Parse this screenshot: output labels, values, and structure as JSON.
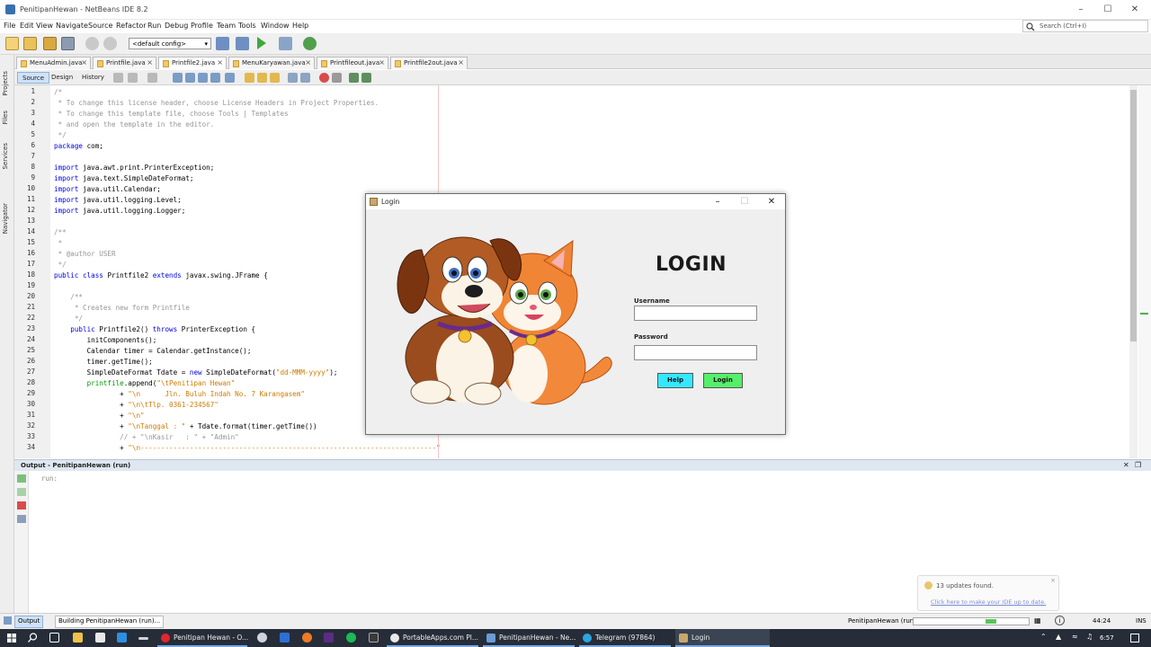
{
  "window": {
    "title": "PenitipanHewan - NetBeans IDE 8.2"
  },
  "menu": [
    "File",
    "Edit",
    "View",
    "Navigate",
    "Source",
    "Refactor",
    "Run",
    "Debug",
    "Profile",
    "Team",
    "Tools",
    "Window",
    "Help"
  ],
  "search": {
    "placeholder": "Search (Ctrl+I)"
  },
  "toolbar": {
    "config": "<default config>"
  },
  "side_tabs": [
    "Projects",
    "Files",
    "Services",
    "Navigator"
  ],
  "editor_tabs": [
    "MenuAdmin.java",
    "Printfile.java",
    "Printfile2.java",
    "MenuKaryawan.java",
    "Printfileout.java",
    "Printfile2out.java"
  ],
  "view_tabs": {
    "source": "Source",
    "design": "Design",
    "history": "History"
  },
  "code": {
    "line_numbers": [
      "1",
      "2",
      "3",
      "4",
      "5",
      "6",
      "7",
      "8",
      "9",
      "10",
      "11",
      "12",
      "13",
      "14",
      "15",
      "16",
      "17",
      "18",
      "19",
      "20",
      "21",
      "22",
      "23",
      "24",
      "25",
      "26",
      "27",
      "28",
      "29",
      "30",
      "31",
      "32",
      "33",
      "34"
    ],
    "lines": [
      [
        [
          "cmt",
          "/*"
        ]
      ],
      [
        [
          "cmt",
          " * To change this license header, choose License Headers in Project Properties."
        ]
      ],
      [
        [
          "cmt",
          " * To change this template file, choose Tools | Templates"
        ]
      ],
      [
        [
          "cmt",
          " * and open the template in the editor."
        ]
      ],
      [
        [
          "cmt",
          " */"
        ]
      ],
      [
        [
          "kw",
          "package"
        ],
        [
          "plain",
          " com;"
        ]
      ],
      [
        [
          "plain",
          ""
        ]
      ],
      [
        [
          "kw",
          "import"
        ],
        [
          "plain",
          " java.awt.print.PrinterException;"
        ]
      ],
      [
        [
          "kw",
          "import"
        ],
        [
          "plain",
          " java.text.SimpleDateFormat;"
        ]
      ],
      [
        [
          "kw",
          "import"
        ],
        [
          "plain",
          " java.util.Calendar;"
        ]
      ],
      [
        [
          "kw",
          "import"
        ],
        [
          "plain",
          " java.util.logging.Level;"
        ]
      ],
      [
        [
          "kw",
          "import"
        ],
        [
          "plain",
          " java.util.logging.Logger;"
        ]
      ],
      [
        [
          "plain",
          ""
        ]
      ],
      [
        [
          "cmt",
          "/**"
        ]
      ],
      [
        [
          "cmt",
          " *"
        ]
      ],
      [
        [
          "cmt",
          " * @author USER"
        ]
      ],
      [
        [
          "cmt",
          " */"
        ]
      ],
      [
        [
          "kw",
          "public class"
        ],
        [
          "plain",
          " Printfile2 "
        ],
        [
          "kw",
          "extends"
        ],
        [
          "plain",
          " javax.swing.JFrame {"
        ]
      ],
      [
        [
          "plain",
          ""
        ]
      ],
      [
        [
          "cmt",
          "    /**"
        ]
      ],
      [
        [
          "cmt",
          "     * Creates new form Printfile"
        ]
      ],
      [
        [
          "cmt",
          "     */"
        ]
      ],
      [
        [
          "kw",
          "    public"
        ],
        [
          "plain",
          " Printfile2() "
        ],
        [
          "kw",
          "throws"
        ],
        [
          "plain",
          " PrinterException {"
        ]
      ],
      [
        [
          "plain",
          "        initComponents();"
        ]
      ],
      [
        [
          "plain",
          "        Calendar timer = Calendar.getInstance();"
        ]
      ],
      [
        [
          "plain",
          "        timer.getTime();"
        ]
      ],
      [
        [
          "plain",
          "        SimpleDateFormat Tdate = "
        ],
        [
          "kw",
          "new"
        ],
        [
          "plain",
          " SimpleDateFormat("
        ],
        [
          "str",
          "\"dd-MMM-yyyy\""
        ],
        [
          "plain",
          ");"
        ]
      ],
      [
        [
          "fld",
          "        printfile"
        ],
        [
          "plain",
          ".append("
        ],
        [
          "str",
          "\"\\tPenitipan Hewan\""
        ]
      ],
      [
        [
          "plain",
          "                + "
        ],
        [
          "str",
          "\"\\n      Jln. Buluh Indah No. 7 Karangasem\""
        ]
      ],
      [
        [
          "plain",
          "                + "
        ],
        [
          "str",
          "\"\\n\\tTlp. 0361-234567\""
        ]
      ],
      [
        [
          "plain",
          "                + "
        ],
        [
          "str",
          "\"\\n\""
        ]
      ],
      [
        [
          "plain",
          "                + "
        ],
        [
          "str",
          "\"\\nTanggal : \""
        ],
        [
          "plain",
          " + Tdate.format(timer.getTime())"
        ]
      ],
      [
        [
          "cmt",
          "                // + \"\\nKasir   : \" + \"Admin\""
        ]
      ],
      [
        [
          "plain",
          "                + "
        ],
        [
          "str",
          "\"\\n------------------------------------------------------------------------\""
        ]
      ]
    ]
  },
  "output": {
    "title": "Output - PenitipanHewan (run)",
    "text": "run:"
  },
  "notification": {
    "title": "13 updates found.",
    "link": "Click here to make your IDE up to date."
  },
  "status": {
    "output_tab": "Output",
    "building": "Building PenitipanHewan (run)...",
    "project": "PenitipanHewan (run)",
    "position": "44:24",
    "mode": "INS"
  },
  "taskbar": {
    "items": [
      "Penitipan Hewan - O...",
      "PortableApps.com Pl...",
      "PenitipanHewan - Ne...",
      "Telegram (97864)",
      "Login"
    ],
    "time": "6:57"
  },
  "login": {
    "window_title": "Login",
    "heading": "LOGIN",
    "username_label": "Username",
    "password_label": "Password",
    "help_button": "Help",
    "login_button": "Login",
    "help_color": "#34e8ff",
    "login_color": "#55f06a"
  }
}
